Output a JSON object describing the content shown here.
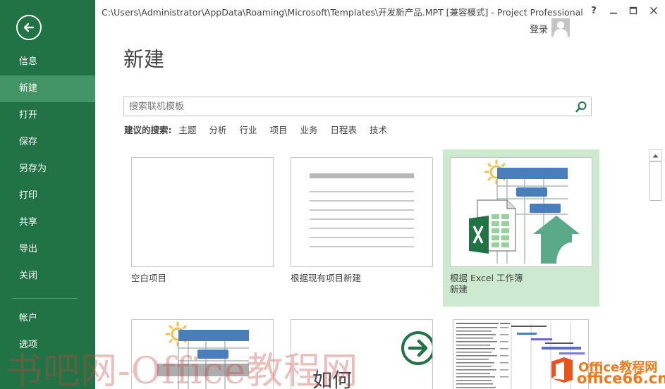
{
  "window": {
    "title": "C:\\Users\\Administrator\\AppData\\Roaming\\Microsoft\\Templates\\开发新产品.MPT [兼容模式] - Project Professional",
    "help_icon": "question-mark-icon",
    "login_label": "登录"
  },
  "sidebar": {
    "back_icon": "back-arrow-icon",
    "items": [
      {
        "label": "信息"
      },
      {
        "label": "新建"
      },
      {
        "label": "打开"
      },
      {
        "label": "保存"
      },
      {
        "label": "另存为"
      },
      {
        "label": "打印"
      },
      {
        "label": "共享"
      },
      {
        "label": "导出"
      },
      {
        "label": "关闭"
      }
    ],
    "bottom_items": [
      {
        "label": "帐户"
      },
      {
        "label": "选项"
      }
    ],
    "active_item": "新建"
  },
  "main": {
    "title": "新建",
    "search": {
      "placeholder": "搜索联机模板"
    },
    "suggested": {
      "label": "建议的搜索:",
      "items": [
        "主题",
        "分析",
        "行业",
        "项目",
        "业务",
        "日程表",
        "技术"
      ]
    },
    "templates": [
      {
        "label": "空白项目"
      },
      {
        "label": "根据现有项目新建"
      },
      {
        "label_line1": "根据 Excel 工作簿",
        "label_line2": "新建"
      }
    ],
    "partial_tile_text": "如何"
  },
  "colors": {
    "sidebar_bg": "#217346",
    "sidebar_active": "#439467",
    "tile_selected": "#cde9cf",
    "excel_green": "#217346",
    "bar_blue": "#4a7ebb"
  },
  "watermarks": {
    "left_text": "书吧网-Office教程网",
    "right_line1": "Office教程网",
    "right_line2": "office66.cn"
  }
}
